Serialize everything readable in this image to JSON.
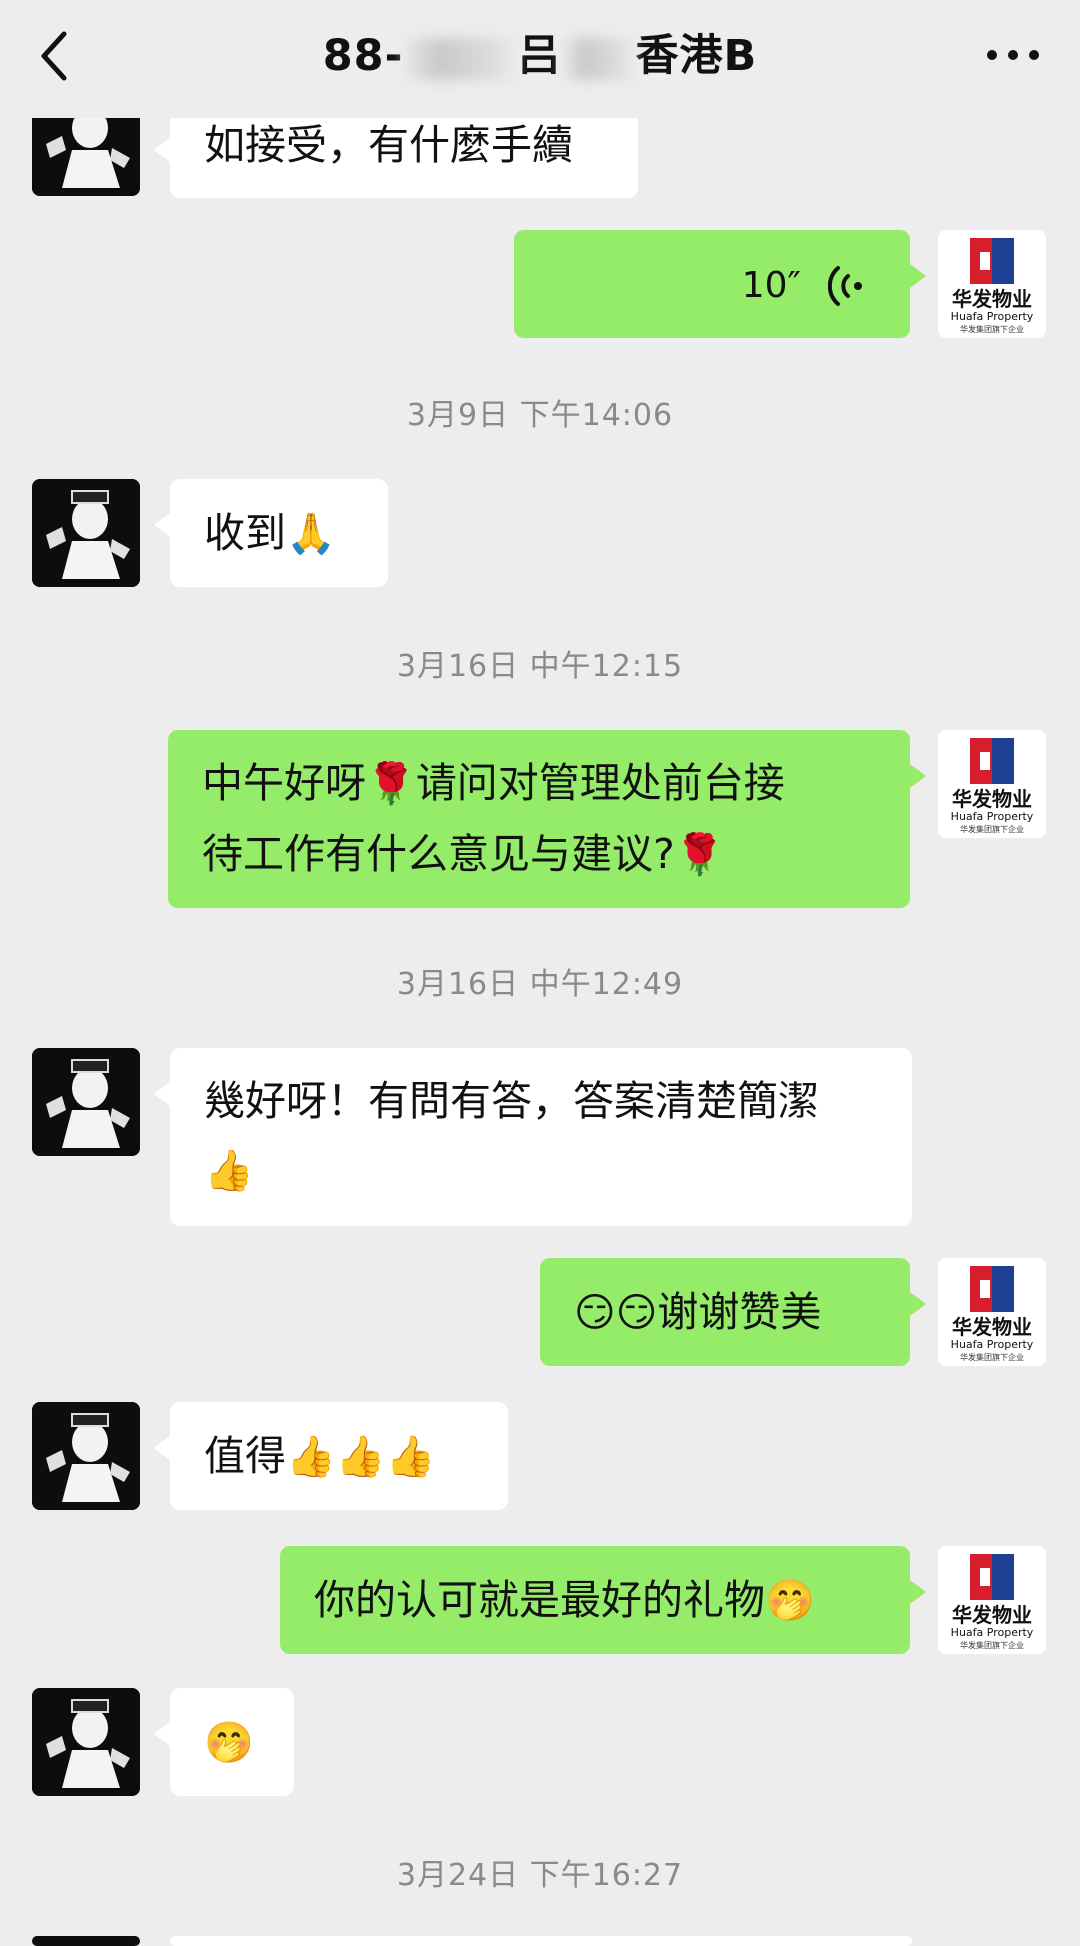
{
  "header": {
    "title_prefix": "88-",
    "title_mid": "吕",
    "title_suffix": "香港B"
  },
  "icons": {
    "back": "chevron-left-icon",
    "more": "more-dots-icon",
    "voice": "voice-wave-icon",
    "rose": "rose-emoji",
    "thumbs_up": "thumbs-up-emoji",
    "folded_hands": "folded-hands-emoji",
    "smirk": "smirk-emoji",
    "shy": "shy-emoji"
  },
  "logo": {
    "name_cn": "华发物业",
    "name_en": "Huafa Property",
    "tagline": "华发集团旗下企业"
  },
  "messages": {
    "m1": {
      "text": "如接受，有什麼手續"
    },
    "m2": {
      "duration": "10″"
    },
    "t1": "3月9日 下午14:06",
    "m3": {
      "text": "收到",
      "emoji": "🙏"
    },
    "t2": "3月16日 中午12:15",
    "m4": {
      "line1": "中午好呀",
      "line1b": "请问对管理处前台接",
      "line2": "待工作有什么意见与建议?",
      "emoji": "🌹"
    },
    "t3": "3月16日 中午12:49",
    "m5": {
      "line1": "幾好呀！有問有答，答案清楚簡潔",
      "emoji": "👍"
    },
    "m6": {
      "emoji": "😏😏",
      "text": "谢谢赞美"
    },
    "m7": {
      "text": "值得",
      "emoji": "👍👍👍"
    },
    "m8": {
      "text": "你的认可就是最好的礼物",
      "emoji": "🤭"
    },
    "m9": {
      "emoji": "🤭"
    },
    "t4": "3月24日 下午16:27"
  },
  "colors": {
    "background": "#ededed",
    "bubble_out": "#95ec69",
    "bubble_in": "#ffffff",
    "timestamp": "#8a8a8a",
    "logo_red": "#d61f2c",
    "logo_blue": "#1f3f94"
  }
}
